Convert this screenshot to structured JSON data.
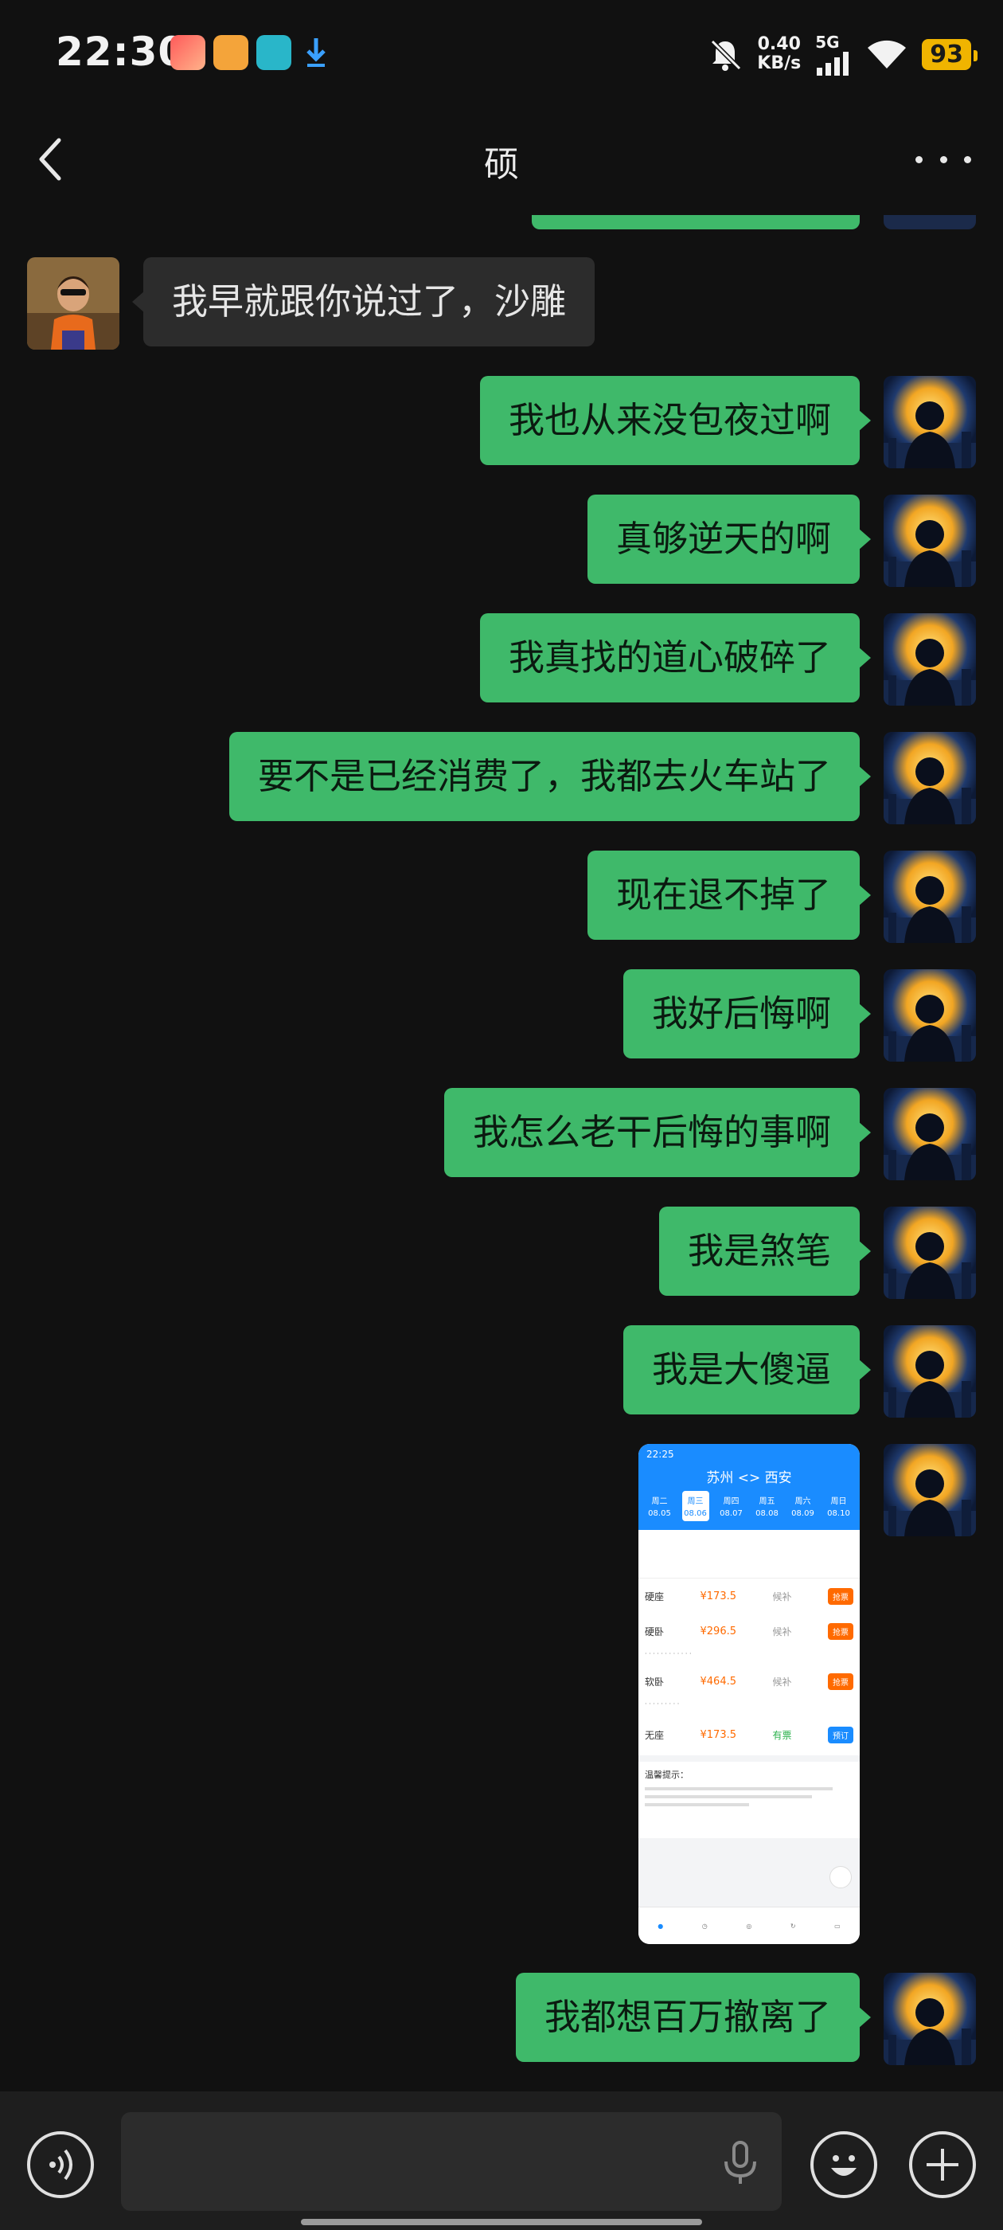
{
  "status_bar": {
    "time": "22:30",
    "network_speed_value": "0.40",
    "network_speed_unit": "KB/s",
    "network_type": "5G",
    "battery": "93"
  },
  "header": {
    "title": "硕"
  },
  "messages": [
    {
      "from": "other",
      "text": "我早就跟你说过了，沙雕"
    },
    {
      "from": "me",
      "text": "我也从来没包夜过啊"
    },
    {
      "from": "me",
      "text": "真够逆天的啊"
    },
    {
      "from": "me",
      "text": "我真找的道心破碎了"
    },
    {
      "from": "me",
      "text": "要不是已经消费了，我都去火车站了"
    },
    {
      "from": "me",
      "text": "现在退不掉了"
    },
    {
      "from": "me",
      "text": "我好后悔啊"
    },
    {
      "from": "me",
      "text": "我怎么老干后悔的事啊"
    },
    {
      "from": "me",
      "text": "我是煞笔"
    },
    {
      "from": "me",
      "text": "我是大傻逼"
    },
    {
      "from": "me",
      "text": "我都想百万撤离了"
    }
  ],
  "image_message": {
    "status_time": "22:25",
    "title": "苏州 <> 西安",
    "dates": [
      {
        "day": "周二",
        "date": "08.05"
      },
      {
        "day": "周三",
        "date": "08.06"
      },
      {
        "day": "周四",
        "date": "08.07"
      },
      {
        "day": "周五",
        "date": "08.08"
      },
      {
        "day": "周六",
        "date": "08.09"
      },
      {
        "day": "周日",
        "date": "08.10"
      }
    ],
    "rows": [
      {
        "seat": "硬座",
        "price": "¥173.5",
        "status": "候补",
        "button": "抢票"
      },
      {
        "seat": "硬卧",
        "price": "¥296.5",
        "status": "候补",
        "button": "抢票"
      },
      {
        "seat": "软卧",
        "price": "¥464.5",
        "status": "候补",
        "button": "抢票"
      },
      {
        "seat": "无座",
        "price": "¥173.5",
        "status": "有票",
        "button": "预订"
      }
    ],
    "tip_title": "温馨提示："
  },
  "colors": {
    "my_bubble": "#3fb96a",
    "their_bubble": "#2c2c2c",
    "background": "#111111",
    "battery": "#f0b400"
  },
  "icons": {
    "back": "chevron-left-icon",
    "more": "more-dots-icon",
    "voice": "voice-icon",
    "mic": "microphone-icon",
    "emoji": "emoji-icon",
    "plus": "plus-icon"
  }
}
